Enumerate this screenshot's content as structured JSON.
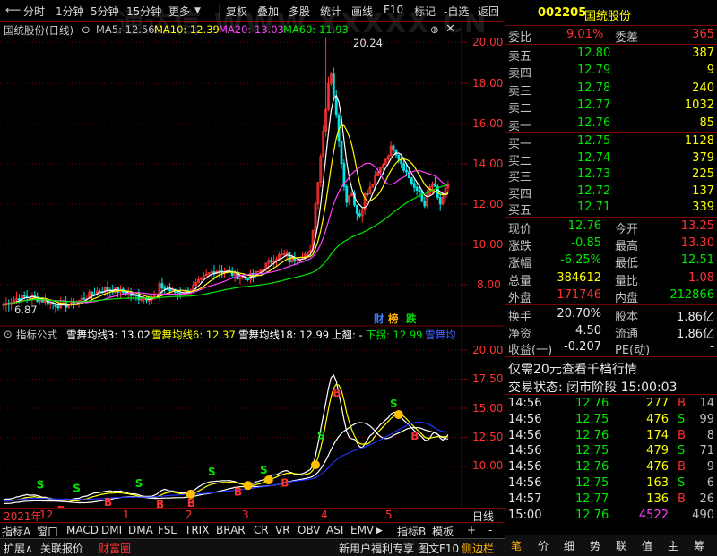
{
  "toolbar": {
    "left_items": [
      "分时",
      "1分钟",
      "5分钟",
      "15分钟",
      "更多",
      "复权",
      "叠加",
      "多股",
      "统计",
      "画线",
      "F10",
      "标记",
      "-自选",
      "返回"
    ],
    "watermark": "通达信 WWW.XXXXX.CN"
  },
  "main_chart": {
    "title": "国统股份(日线)",
    "ma_labels": [
      {
        "text": "MA5: 12.56",
        "color": "#ffffff"
      },
      {
        "text": "MA10: 12.39",
        "color": "#ffff00"
      },
      {
        "text": "MA20: 13.03",
        "color": "#ff40ff"
      },
      {
        "text": "MA60: 11.93",
        "color": "#00e600"
      }
    ],
    "y_ticks": [
      "20.00",
      "18.00",
      "16.00",
      "14.00",
      "12.00",
      "10.00",
      "8.00"
    ],
    "high_label": "20.24",
    "low_label": "6.87",
    "badges": [
      {
        "text": "财",
        "color": "#4080ff"
      },
      {
        "text": "榜",
        "color": "#ffb000"
      },
      {
        "text": "跌",
        "color": "#00e600"
      }
    ]
  },
  "indicator_chart": {
    "title": "指标公式",
    "labels": [
      {
        "text": "雪舞均线3: 13.02",
        "color": "#ffffff"
      },
      {
        "text": "雪舞均线6: 12.37",
        "color": "#ffff00"
      },
      {
        "text": "雪舞均线18: 12.99",
        "color": "#ffffff"
      },
      {
        "text": "上翘: -",
        "color": "#ffffff"
      },
      {
        "text": "下拐: 12.99",
        "color": "#00e600"
      },
      {
        "text": "雪舞均",
        "color": "#4060ff"
      }
    ],
    "y_ticks": [
      "20.00",
      "17.50",
      "15.00",
      "12.50",
      "10.00"
    ],
    "markers": [
      "S",
      "B"
    ]
  },
  "time_axis": {
    "labels": [
      "2021年",
      "12",
      "1",
      "2",
      "3",
      "4",
      "5"
    ],
    "right_label": "日线"
  },
  "bottom_tabs": [
    "指标A",
    "窗口",
    "MACD",
    "DMI",
    "DMA",
    "FSL",
    "TRIX",
    "BRAR",
    "CR",
    "VR",
    "OBV",
    "ASI",
    "EMV",
    "指标B",
    "模板",
    "+",
    "-"
  ],
  "status_bar": {
    "left": [
      "扩展∧",
      "关联报价",
      "财富圈"
    ],
    "mid": [
      "新用户福利专享",
      "图文F10",
      "侧边栏"
    ],
    "right": [
      "笔",
      "价",
      "细",
      "势",
      "联",
      "值",
      "主",
      "筹"
    ]
  },
  "quote": {
    "code": "002205",
    "name": "国统股份",
    "weibi_label": "委比",
    "weibi": "9.01%",
    "weicha_label": "委差",
    "weicha": "365",
    "sells": [
      {
        "label": "卖五",
        "price": "12.80",
        "vol": "387"
      },
      {
        "label": "卖四",
        "price": "12.79",
        "vol": "9"
      },
      {
        "label": "卖三",
        "price": "12.78",
        "vol": "240"
      },
      {
        "label": "卖二",
        "price": "12.77",
        "vol": "1032"
      },
      {
        "label": "卖一",
        "price": "12.76",
        "vol": "85"
      }
    ],
    "buys": [
      {
        "label": "买一",
        "price": "12.75",
        "vol": "1128"
      },
      {
        "label": "买二",
        "price": "12.74",
        "vol": "379"
      },
      {
        "label": "买三",
        "price": "12.73",
        "vol": "225"
      },
      {
        "label": "买四",
        "price": "12.72",
        "vol": "137"
      },
      {
        "label": "买五",
        "price": "12.71",
        "vol": "339"
      }
    ],
    "stats": [
      {
        "l1": "现价",
        "v1": "12.76",
        "c1": "#00e600",
        "l2": "今开",
        "v2": "13.25",
        "c2": "#ff3232"
      },
      {
        "l1": "涨跌",
        "v1": "-0.85",
        "c1": "#00e600",
        "l2": "最高",
        "v2": "13.30",
        "c2": "#ff3232"
      },
      {
        "l1": "涨幅",
        "v1": "-6.25%",
        "c1": "#00e600",
        "l2": "最低",
        "v2": "12.51",
        "c2": "#00e600"
      },
      {
        "l1": "总量",
        "v1": "384612",
        "c1": "#ffff00",
        "l2": "量比",
        "v2": "1.08",
        "c2": "#ff3232"
      },
      {
        "l1": "外盘",
        "v1": "171746",
        "c1": "#ff3232",
        "l2": "内盘",
        "v2": "212866",
        "c2": "#00e600"
      }
    ],
    "stats2": [
      {
        "l1": "换手",
        "v1": "20.70%",
        "l2": "股本",
        "v2": "1.86亿"
      },
      {
        "l1": "净资",
        "v1": "4.50",
        "l2": "流通",
        "v2": "1.86亿"
      },
      {
        "l1": "收益(一)",
        "v1": "-0.207",
        "l2": "PE(动)",
        "v2": "-"
      }
    ],
    "promo": "仅需20元查看千档行情",
    "trade_status": "交易状态: 闭市阶段 15:00:03",
    "ticks": [
      {
        "t": "14:56",
        "p": "12.76",
        "v": "277",
        "bs": "B",
        "vc": "#ffff00"
      },
      {
        "t": "14:56",
        "p": "12.75",
        "v": "476",
        "bs": "S",
        "vc": "#ffff00"
      },
      {
        "t": "14:56",
        "p": "12.76",
        "v": "174",
        "bs": "B",
        "vc": "#ffff00"
      },
      {
        "t": "14:56",
        "p": "12.75",
        "v": "479",
        "bs": "S",
        "vc": "#ffff00"
      },
      {
        "t": "14:56",
        "p": "12.76",
        "v": "476",
        "bs": "B",
        "vc": "#ffff00"
      },
      {
        "t": "14:56",
        "p": "12.75",
        "v": "163",
        "bs": "S",
        "vc": "#ffff00"
      },
      {
        "t": "14:57",
        "p": "12.77",
        "v": "136",
        "bs": "B",
        "vc": "#ffff00"
      },
      {
        "t": "15:00",
        "p": "12.76",
        "v": "4522",
        "bs": "",
        "vc": "#ff40ff"
      }
    ],
    "tick_side_numbers": [
      "14",
      "99",
      "8",
      "71",
      "9",
      "6",
      "26",
      "490"
    ]
  },
  "colors": {
    "up": "#ff3232",
    "down": "#00e600",
    "border": "#7a0000",
    "bg": "#000000"
  }
}
